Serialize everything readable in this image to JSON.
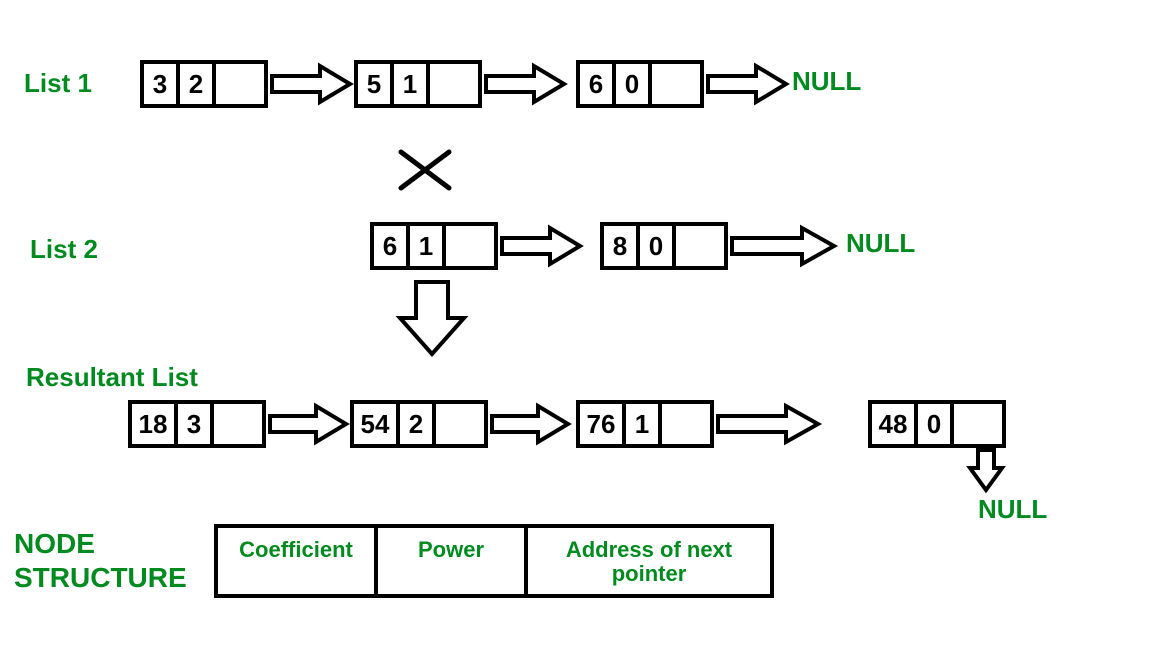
{
  "labels": {
    "list1": "List 1",
    "list2": "List 2",
    "result": "Resultant List",
    "nodeStruct1": "NODE",
    "nodeStruct2": "STRUCTURE",
    "null": "NULL"
  },
  "legend": {
    "coef": "Coefficient",
    "power": "Power",
    "addr": "Address of next pointer"
  },
  "list1": [
    {
      "coef": "3",
      "power": "2"
    },
    {
      "coef": "5",
      "power": "1"
    },
    {
      "coef": "6",
      "power": "0"
    }
  ],
  "list2": [
    {
      "coef": "6",
      "power": "1"
    },
    {
      "coef": "8",
      "power": "0"
    }
  ],
  "result": [
    {
      "coef": "18",
      "power": "3"
    },
    {
      "coef": "54",
      "power": "2"
    },
    {
      "coef": "76",
      "power": "1"
    },
    {
      "coef": "48",
      "power": "0"
    }
  ],
  "chart_data": {
    "type": "table",
    "title": "Polynomial multiplication via linked lists",
    "node_fields": [
      "Coefficient",
      "Power",
      "Address of next pointer"
    ],
    "list1_nodes": [
      [
        3,
        2
      ],
      [
        5,
        1
      ],
      [
        6,
        0
      ]
    ],
    "list2_nodes": [
      [
        6,
        1
      ],
      [
        8,
        0
      ]
    ],
    "result_nodes": [
      [
        18,
        3
      ],
      [
        54,
        2
      ],
      [
        76,
        1
      ],
      [
        48,
        0
      ]
    ],
    "operation": "multiply",
    "terminator": "NULL"
  }
}
